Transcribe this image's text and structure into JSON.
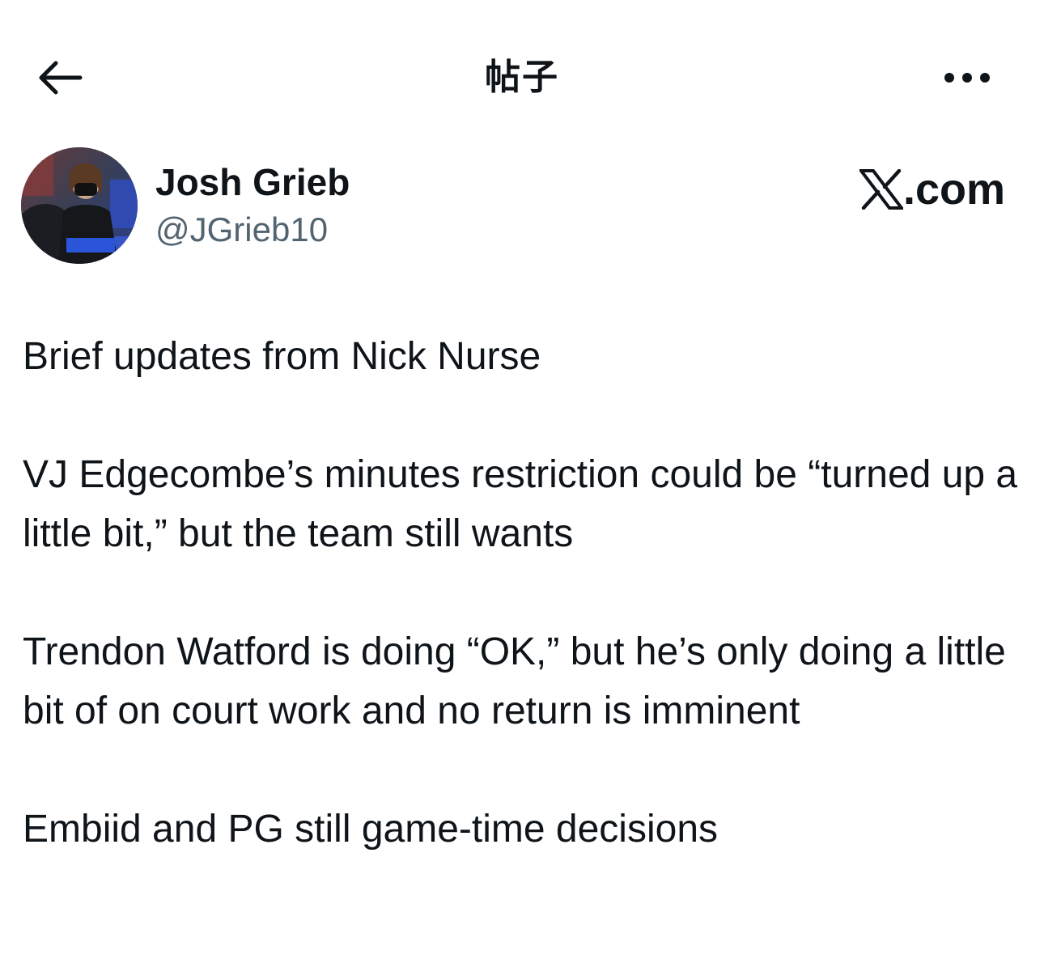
{
  "header": {
    "title": "帖子",
    "back_icon": "arrow-left-icon",
    "more_icon": "more-horizontal-icon"
  },
  "author": {
    "name": "Josh Grieb",
    "handle": "@JGrieb10",
    "avatar": "avatar-photo"
  },
  "source": {
    "label": ".com",
    "logo": "x-logo-icon"
  },
  "post": {
    "paragraphs": [
      "Brief updates from Nick Nurse",
      "VJ Edgecombe’s minutes restriction could be “turned up a little bit,” but the team still wants",
      "Trendon Watford is doing “OK,” but he’s only doing a little bit of on court work and no return is imminent",
      "Embiid and PG still game-time decisions"
    ]
  },
  "colors": {
    "text_primary": "#0f1419",
    "text_secondary": "#536471",
    "background": "#ffffff"
  }
}
